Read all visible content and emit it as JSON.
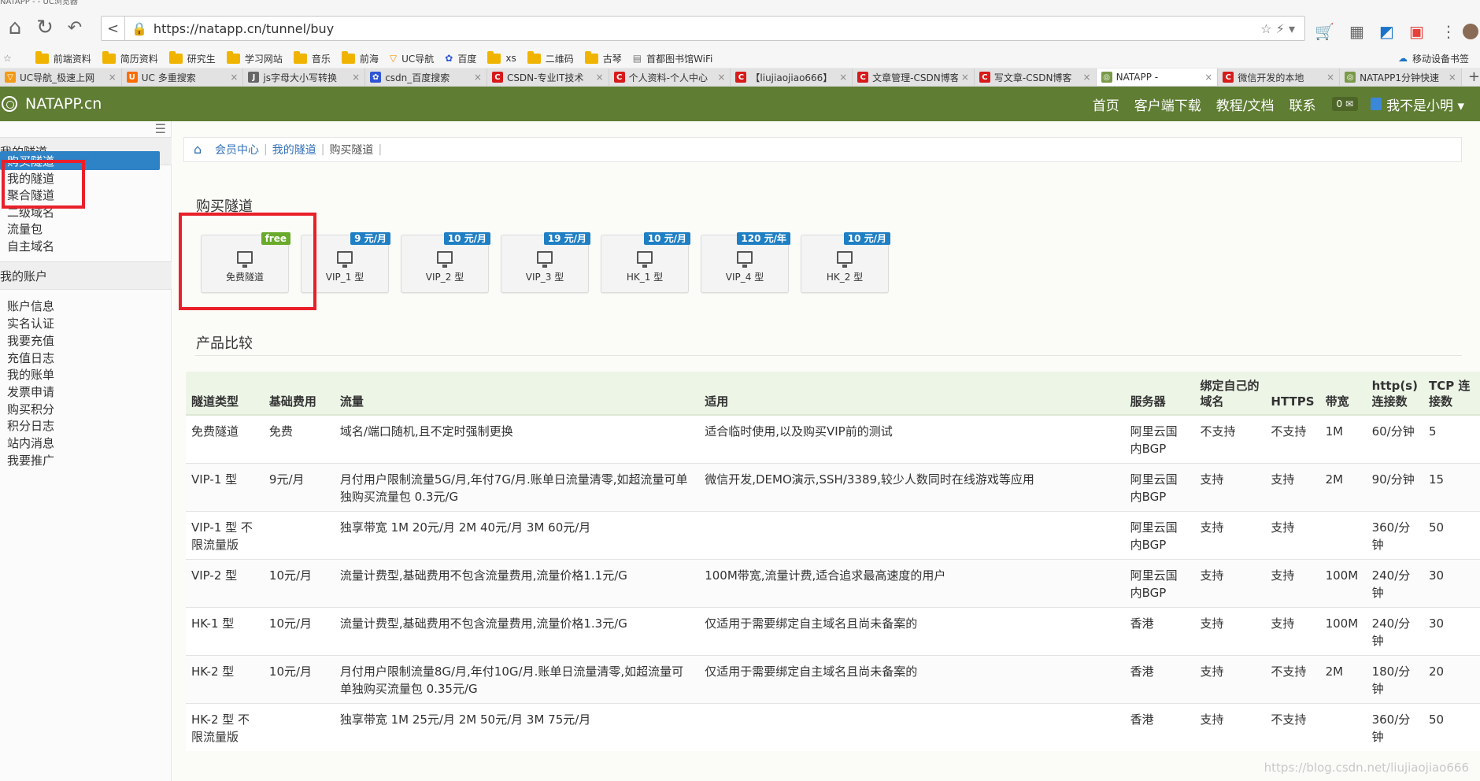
{
  "browser": {
    "title": "NATAPP - - UC浏览器",
    "url": "https://natapp.cn/tunnel/buy",
    "bookmarks": [
      "前端资料",
      "简历资料",
      "研究生",
      "学习网站",
      "音乐",
      "前海",
      "UC导航",
      "百度",
      "xs",
      "二维码",
      "古琴",
      "首都图书馆WiFi",
      "移动设备书签"
    ],
    "tabs": [
      {
        "label": "UC导航_极速上网",
        "color": "#f39a16",
        "glyph": "▽"
      },
      {
        "label": "UC 多重搜索",
        "color": "#ff6c00",
        "glyph": "U"
      },
      {
        "label": "js字母大小写转换",
        "color": "#666666",
        "glyph": "J"
      },
      {
        "label": "csdn_百度搜索",
        "color": "#2f55d4",
        "glyph": "✿"
      },
      {
        "label": "CSDN-专业IT技术",
        "color": "#d71a1a",
        "glyph": "C"
      },
      {
        "label": "个人资料-个人中心",
        "color": "#d71a1a",
        "glyph": "C"
      },
      {
        "label": "【liujiaojiao666】",
        "color": "#d71a1a",
        "glyph": "C"
      },
      {
        "label": "文章管理-CSDN博客",
        "color": "#d71a1a",
        "glyph": "C"
      },
      {
        "label": "写文章-CSDN博客",
        "color": "#d71a1a",
        "glyph": "C"
      },
      {
        "label": "NATAPP -",
        "color": "#7a9a4a",
        "glyph": "◎"
      },
      {
        "label": "微信开发的本地",
        "color": "#d71a1a",
        "glyph": "C"
      },
      {
        "label": "NATAPP1分钟快速",
        "color": "#7a9a4a",
        "glyph": "◎"
      }
    ],
    "active_tab": 9
  },
  "header": {
    "logo": "NATAPP.cn",
    "nav": [
      "首页",
      "客户端下载",
      "教程/文档",
      "联系"
    ],
    "message_count": "0",
    "user": "我不是小明 ▾"
  },
  "sidebar": {
    "group1": "我的隧道",
    "group1_items": [
      "购买隧道",
      "我的隧道",
      "聚合隧道",
      "二级域名",
      "流量包",
      "自主域名"
    ],
    "group2": "我的账户",
    "group2_items": [
      "账户信息",
      "实名认证",
      "我要充值",
      "充值日志",
      "我的账单",
      "发票申请",
      "购买积分",
      "积分日志",
      "站内消息",
      "我要推广"
    ]
  },
  "breadcrumb": {
    "items": [
      "会员中心",
      "我的隧道"
    ],
    "current": "购买隧道"
  },
  "buy_section": {
    "title": "购买隧道",
    "plans": [
      {
        "label": "免费隧道",
        "badge": "free"
      },
      {
        "label": "VIP_1 型",
        "badge": "9 元/月"
      },
      {
        "label": "VIP_2 型",
        "badge": "10 元/月"
      },
      {
        "label": "VIP_3 型",
        "badge": "19 元/月"
      },
      {
        "label": "HK_1 型",
        "badge": "10 元/月"
      },
      {
        "label": "VIP_4 型",
        "badge": "120 元/年"
      },
      {
        "label": "HK_2 型",
        "badge": "10 元/月"
      }
    ]
  },
  "compare": {
    "title": "产品比较",
    "headers": [
      "隧道类型",
      "基础费用",
      "流量",
      "适用",
      "服务器",
      "绑定自己的域名",
      "HTTPS",
      "带宽",
      "http(s) 连接数",
      "TCP 连接数"
    ],
    "rows": [
      [
        "免费隧道",
        "免费",
        "域名/端口随机,且不定时强制更换",
        "适合临时使用,以及购买VIP前的测试",
        "阿里云国内BGP",
        "不支持",
        "不支持",
        "1M",
        "60/分钟",
        "5"
      ],
      [
        "VIP-1 型",
        "9元/月",
        "月付用户限制流量5G/月,年付7G/月.账单日流量清零,如超流量可单独购买流量包 0.3元/G",
        "微信开发,DEMO演示,SSH/3389,较少人数同时在线游戏等应用",
        "阿里云国内BGP",
        "支持",
        "支持",
        "2M",
        "90/分钟",
        "15"
      ],
      [
        "VIP-1 型 不限流量版",
        "",
        "独享带宽 1M 20元/月 2M 40元/月 3M 60元/月",
        "",
        "阿里云国内BGP",
        "支持",
        "支持",
        "",
        "360/分钟",
        "50"
      ],
      [
        "VIP-2 型",
        "10元/月",
        "流量计费型,基础费用不包含流量费用,流量价格1.1元/G",
        "100M带宽,流量计费,适合追求最高速度的用户",
        "阿里云国内BGP",
        "支持",
        "支持",
        "100M",
        "240/分钟",
        "30"
      ],
      [
        "HK-1 型",
        "10元/月",
        "流量计费型,基础费用不包含流量费用,流量价格1.3元/G",
        "仅适用于需要绑定自主域名且尚未备案的",
        "香港",
        "支持",
        "支持",
        "100M",
        "240/分钟",
        "30"
      ],
      [
        "HK-2 型",
        "10元/月",
        "月付用户限制流量8G/月,年付10G/月.账单日流量清零,如超流量可单独购买流量包 0.35元/G",
        "仅适用于需要绑定自主域名且尚未备案的",
        "香港",
        "支持",
        "不支持",
        "2M",
        "180/分钟",
        "20"
      ],
      [
        "HK-2 型 不限流量版",
        "",
        "独享带宽 1M 25元/月 2M 50元/月 3M 75元/月",
        "",
        "香港",
        "支持",
        "不支持",
        "",
        "360/分钟",
        "50"
      ]
    ]
  },
  "watermark": "https://blog.csdn.net/liujiaojiao666"
}
